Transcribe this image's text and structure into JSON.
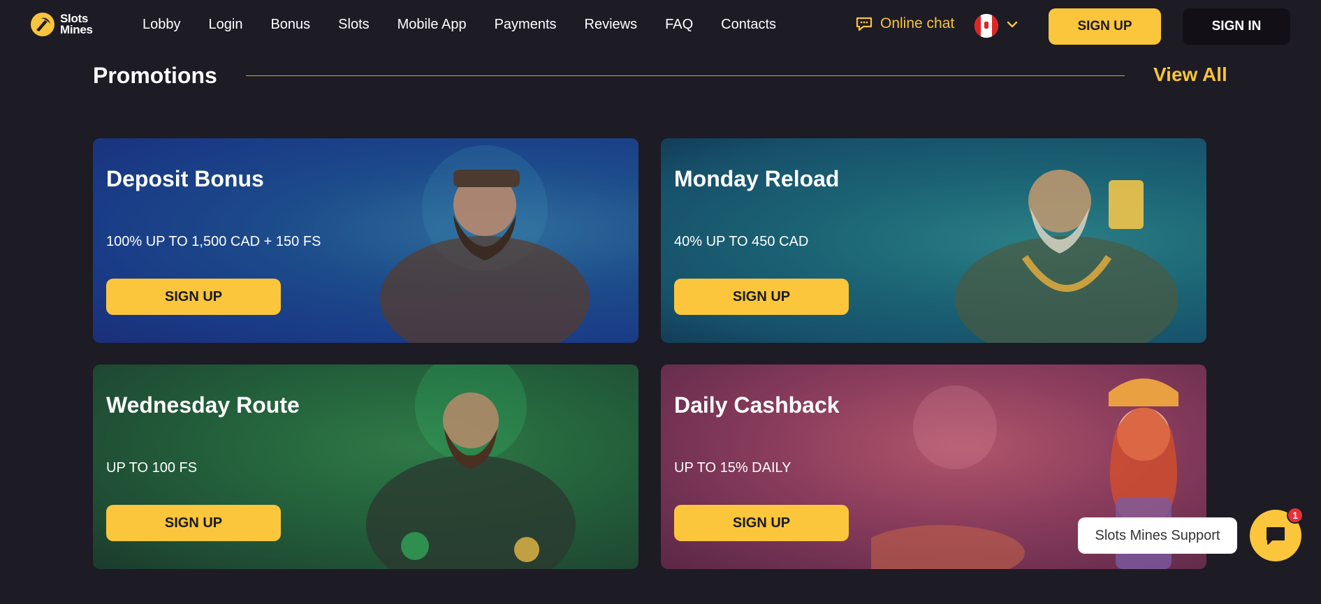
{
  "header": {
    "logo_line1": "Slots",
    "logo_line2": "Mines",
    "nav": [
      "Lobby",
      "Login",
      "Bonus",
      "Slots",
      "Mobile App",
      "Payments",
      "Reviews",
      "FAQ",
      "Contacts"
    ],
    "chat_label": "Online chat",
    "chat_icon": "chat-bubble-icon",
    "language_flag": "flag-canada-icon",
    "signup_label": "SIGN UP",
    "signin_label": "SIGN IN"
  },
  "section": {
    "title": "Promotions",
    "view_all": "View All"
  },
  "promotions": [
    {
      "title": "Deposit Bonus",
      "desc": "100% UP TO 1,500 CAD + 150 FS",
      "button": "SIGN UP"
    },
    {
      "title": "Monday Reload",
      "desc": "40% UP TO 450 CAD",
      "button": "SIGN UP"
    },
    {
      "title": "Wednesday Route",
      "desc": "UP TO 100 FS",
      "button": "SIGN UP"
    },
    {
      "title": "Daily Cashback",
      "desc": "UP TO 15% DAILY",
      "button": "SIGN UP"
    }
  ],
  "support": {
    "label": "Slots Mines Support",
    "badge": "1",
    "icon": "chat-icon"
  },
  "colors": {
    "accent": "#fbc63b",
    "background": "#1d1b24"
  }
}
